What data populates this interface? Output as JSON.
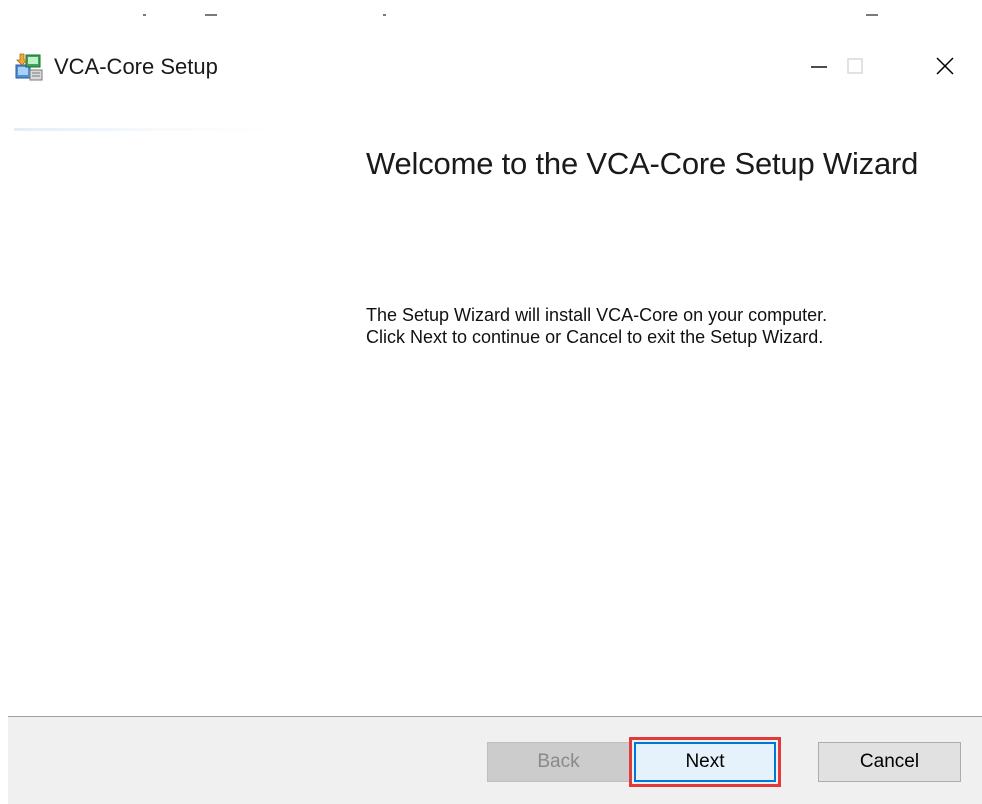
{
  "window": {
    "title": "VCA-Core Setup",
    "controls": {
      "minimize_icon": "minimize-icon",
      "maximize_icon": "maximize-icon",
      "close_icon": "close-icon"
    }
  },
  "main": {
    "heading": "Welcome to the VCA-Core Setup Wizard",
    "description_line1": "The Setup Wizard will install VCA-Core on your computer.",
    "description_line2": "Click Next to continue or Cancel to exit the Setup Wizard."
  },
  "footer": {
    "back_label": "Back",
    "next_label": "Next",
    "cancel_label": "Cancel",
    "back_enabled": false
  },
  "colors": {
    "highlight": "#e03a3a",
    "focus_border": "#0078d7",
    "footer_bg": "#f0f0f0"
  }
}
